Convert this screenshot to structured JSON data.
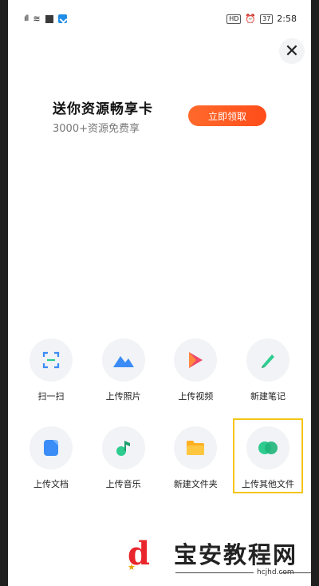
{
  "status_bar": {
    "time": "2:58",
    "battery": "37"
  },
  "promo": {
    "title": "送你资源畅享卡",
    "subtitle": "3000+资源免费享",
    "button_label": "立即领取"
  },
  "actions": [
    {
      "label": "扫一扫",
      "icon": "scan-icon"
    },
    {
      "label": "上传照片",
      "icon": "photo-icon"
    },
    {
      "label": "上传视频",
      "icon": "video-icon"
    },
    {
      "label": "新建笔记",
      "icon": "pen-icon"
    },
    {
      "label": "上传文档",
      "icon": "document-icon"
    },
    {
      "label": "上传音乐",
      "icon": "music-icon"
    },
    {
      "label": "新建文件夹",
      "icon": "folder-icon"
    },
    {
      "label": "上传其他文件",
      "icon": "other-files-icon"
    }
  ],
  "watermark": {
    "text": "宝安教程网",
    "domain": "hcjhd.com"
  },
  "colors": {
    "accent": "#ff5a1f",
    "highlight": "#f5c518",
    "icon_blue": "#3b8cf6",
    "icon_green": "#2ecc8f"
  }
}
